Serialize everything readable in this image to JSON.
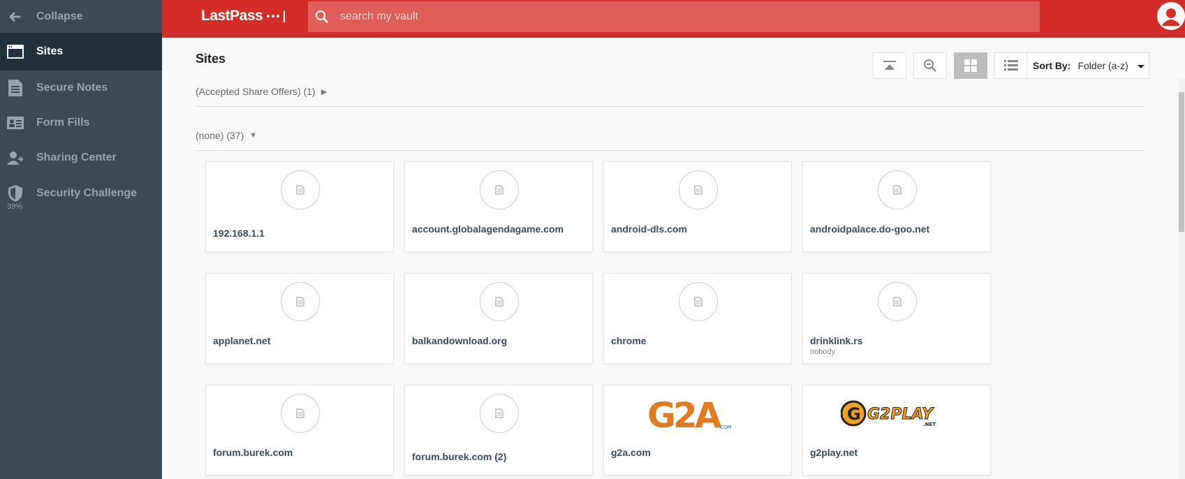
{
  "sidebar": {
    "collapse_label": "Collapse",
    "items": [
      {
        "label": "Sites"
      },
      {
        "label": "Secure Notes"
      },
      {
        "label": "Form Fills"
      },
      {
        "label": "Sharing Center"
      },
      {
        "label": "Security Challenge"
      }
    ],
    "security_score": "39%"
  },
  "header": {
    "logo_text": "LastPass",
    "search_placeholder": "search my vault"
  },
  "main": {
    "title": "Sites",
    "sort_label": "Sort By:",
    "sort_value": "Folder (a-z)",
    "folders": [
      {
        "label": "(Accepted Share Offers) (1)",
        "arrow": "▶"
      },
      {
        "label": "(none) (37)",
        "arrow": "▼"
      }
    ],
    "tiles": [
      {
        "name": "192.168.1.1",
        "sub": ""
      },
      {
        "name": "account.globalagendagame.com",
        "sub": ""
      },
      {
        "name": "android-dls.com",
        "sub": ""
      },
      {
        "name": "androidpalace.do-goo.net",
        "sub": ""
      },
      {
        "name": "applanet.net",
        "sub": ""
      },
      {
        "name": "balkandownload.org",
        "sub": ""
      },
      {
        "name": "chrome",
        "sub": ""
      },
      {
        "name": "drinklink.rs",
        "sub": "nobody"
      },
      {
        "name": "forum.burek.com",
        "sub": ""
      },
      {
        "name": "forum.burek.com (2)",
        "sub": ""
      },
      {
        "name": "g2a.com",
        "sub": "",
        "logo": "G2A",
        "logo_small": ".COM"
      },
      {
        "name": "g2play.net",
        "sub": "",
        "logo": "G2PLAY",
        "logo_small": ".NET"
      }
    ]
  },
  "colors": {
    "brand": "#d32d27",
    "sidebar": "#3b4a55",
    "sidebar_active": "#233039"
  }
}
